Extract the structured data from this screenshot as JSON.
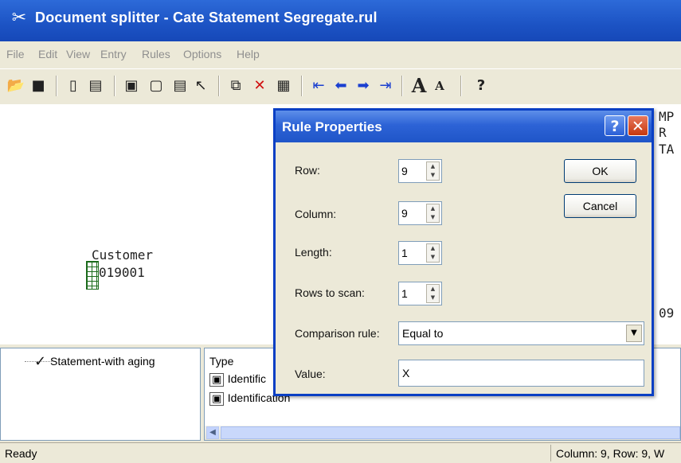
{
  "window": {
    "title": "Document splitter - Cate Statement Segregate.rul"
  },
  "menu": [
    "File",
    "Edit",
    "View",
    "Entry",
    "Rules",
    "Options",
    "Help"
  ],
  "toolbar": {
    "icons": [
      "open-folder-icon",
      "save-icon",
      "new-rule-icon",
      "rule-list-icon",
      "identification-icon",
      "page-icon",
      "doc-icon",
      "pointer-icon",
      "copy-icon",
      "delete-icon",
      "properties-icon",
      "first-icon",
      "prev-icon",
      "next-icon",
      "last-icon",
      "font-larger-icon",
      "font-smaller-icon",
      "help-icon"
    ]
  },
  "document": {
    "right_fragments": [
      "MP",
      "R",
      "TA",
      "09"
    ],
    "customer_label": "Customer",
    "customer_id": "019001"
  },
  "tree": {
    "item": "Statement-with aging"
  },
  "list": {
    "header": "Type",
    "rows": [
      "Identific",
      "Identification"
    ]
  },
  "status": {
    "left": "Ready",
    "right": "Column: 9, Row: 9, W"
  },
  "dialog": {
    "title": "Rule Properties",
    "help_glyph": "?",
    "close_glyph": "✕",
    "row_label": "Row:",
    "row_value": "9",
    "column_label": "Column:",
    "column_value": "9",
    "length_label": "Length:",
    "length_value": "1",
    "rows_to_scan_label": "Rows to scan:",
    "rows_to_scan_value": "1",
    "comparison_label": "Comparison rule:",
    "comparison_value": "Equal to",
    "value_label": "Value:",
    "value_value": "X",
    "ok_label": "OK",
    "cancel_label": "Cancel"
  }
}
